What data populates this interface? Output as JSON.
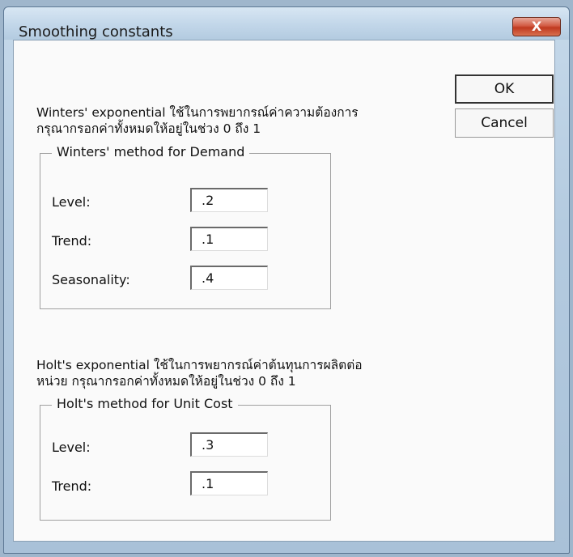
{
  "window": {
    "title": "Smoothing constants"
  },
  "buttons": {
    "close_label": "X",
    "ok_label": "OK",
    "cancel_label": "Cancel"
  },
  "winters": {
    "description_line1": "Winters' exponential ใช้ในการพยากรณ์ค่าความต้องการ",
    "description_line2": "กรุณากรอกค่าทั้งหมดให้อยู่ในช่วง 0 ถึง 1",
    "group_title": "Winters' method for Demand",
    "level_label": "Level:",
    "level_value": ".2",
    "trend_label": "Trend:",
    "trend_value": ".1",
    "seasonality_label": "Seasonality:",
    "seasonality_value": ".4"
  },
  "holt": {
    "description_line1": "Holt's exponential ใช้ในการพยากรณ์ค่าต้นทุนการผลิตต่อ",
    "description_line2": "หน่วย กรุณากรอกค่าทั้งหมดให้อยู่ในช่วง 0 ถึง 1",
    "group_title": "Holt's method for Unit Cost",
    "level_label": "Level:",
    "level_value": ".3",
    "trend_label": "Trend:",
    "trend_value": ".1"
  }
}
